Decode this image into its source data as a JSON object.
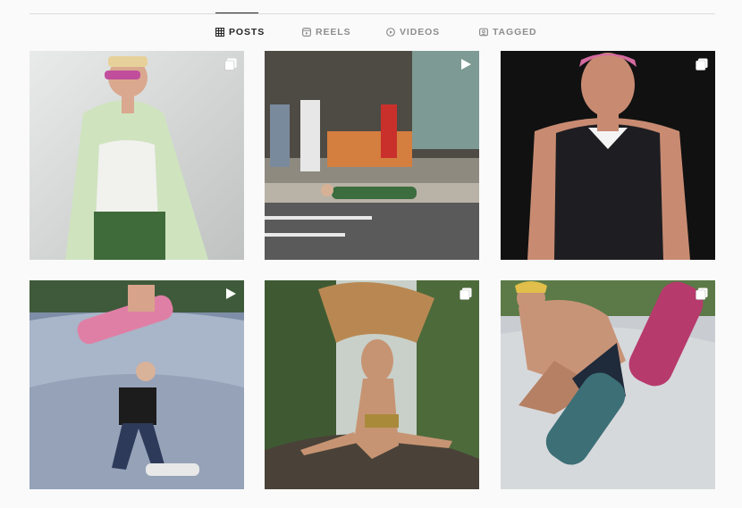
{
  "tabs": [
    {
      "label": "POSTS",
      "icon": "grid-icon",
      "active": true
    },
    {
      "label": "REELS",
      "icon": "reels-icon",
      "active": false
    },
    {
      "label": "VIDEOS",
      "icon": "play-circle-icon",
      "active": false
    },
    {
      "label": "TAGGED",
      "icon": "tag-icon",
      "active": false
    }
  ],
  "posts": [
    {
      "badge": "carousel-icon",
      "subject": "model in pale green jacket and pink sunglasses"
    },
    {
      "badge": "reel-play-icon",
      "subject": "street scene with person lying on crosswalk"
    },
    {
      "badge": "carousel-icon",
      "subject": "model in black sleeveless shirt on runway"
    },
    {
      "badge": "reel-play-icon",
      "subject": "skateboarders in concrete bowl"
    },
    {
      "badge": "carousel-icon",
      "subject": "person with flying hair by waterfall"
    },
    {
      "badge": "carousel-icon",
      "subject": "skater holding pink skateboard in bowl"
    }
  ],
  "colors": {
    "background": "#fafafa",
    "active_tab": "#262626",
    "inactive_tab": "#8e8e8e",
    "divider": "#dbdbdb"
  }
}
